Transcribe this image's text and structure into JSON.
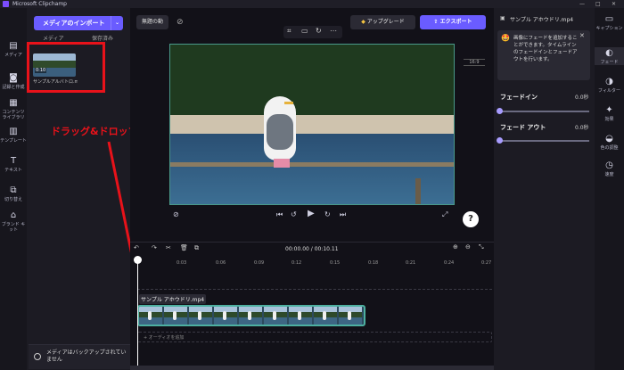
{
  "app": {
    "title": "Microsoft Clipchamp"
  },
  "window_controls": [
    "—",
    "□",
    "✕"
  ],
  "left_nav": [
    {
      "label": "メディア",
      "icon": "media-icon"
    },
    {
      "label": "記録と作成",
      "icon": "record-icon"
    },
    {
      "label": "コンテンツ ライブラリ",
      "icon": "library-icon"
    },
    {
      "label": "テンプレート",
      "icon": "template-icon"
    },
    {
      "label": "テキスト",
      "icon": "text-icon"
    },
    {
      "label": "切り替え",
      "icon": "transition-icon"
    },
    {
      "label": "ブランド キット",
      "icon": "brand-icon"
    }
  ],
  "media_panel": {
    "import_label": "メディアのインポート",
    "tabs": [
      "メディア",
      "保存済み"
    ],
    "item": {
      "duration": "0:10",
      "name": "サンプルアルバトロ.mp4"
    },
    "backup_text": "メディアはバックアップされていません"
  },
  "toolbar": {
    "project_name": "無題の動",
    "upgrade_label": "アップグレード",
    "export_label": "エクスポート"
  },
  "preview": {
    "aspect": "16:9"
  },
  "playback": {
    "current": "00:00.00",
    "total": "00:10.11"
  },
  "annotation": {
    "label": "ドラッグ&ドロップ"
  },
  "right_panel": {
    "file_title": "サンプル アホウドリ.mp4",
    "info": "画像にフェードを追加することができます。タイムラインのフェードインとフェードアウトを行います。",
    "fade_in_label": "フェードイン",
    "fade_in_value": "0.0秒",
    "fade_out_label": "フェード アウト",
    "fade_out_value": "0.0秒"
  },
  "right_nav": [
    {
      "label": "キャプション",
      "icon": "caption-icon"
    },
    {
      "label": "フェード",
      "icon": "fade-icon"
    },
    {
      "label": "フィルター",
      "icon": "filter-icon"
    },
    {
      "label": "効果",
      "icon": "effects-icon"
    },
    {
      "label": "色の調整",
      "icon": "color-icon"
    },
    {
      "label": "速度",
      "icon": "speed-icon"
    }
  ],
  "timeline": {
    "ticks": [
      "0:03",
      "0:06",
      "0:09",
      "0:12",
      "0:15",
      "0:18",
      "0:21",
      "0:24",
      "0:27"
    ],
    "clip_label": "サンプル アホウドリ.mp4",
    "audio_placeholder": "+ オーディオを追加"
  }
}
